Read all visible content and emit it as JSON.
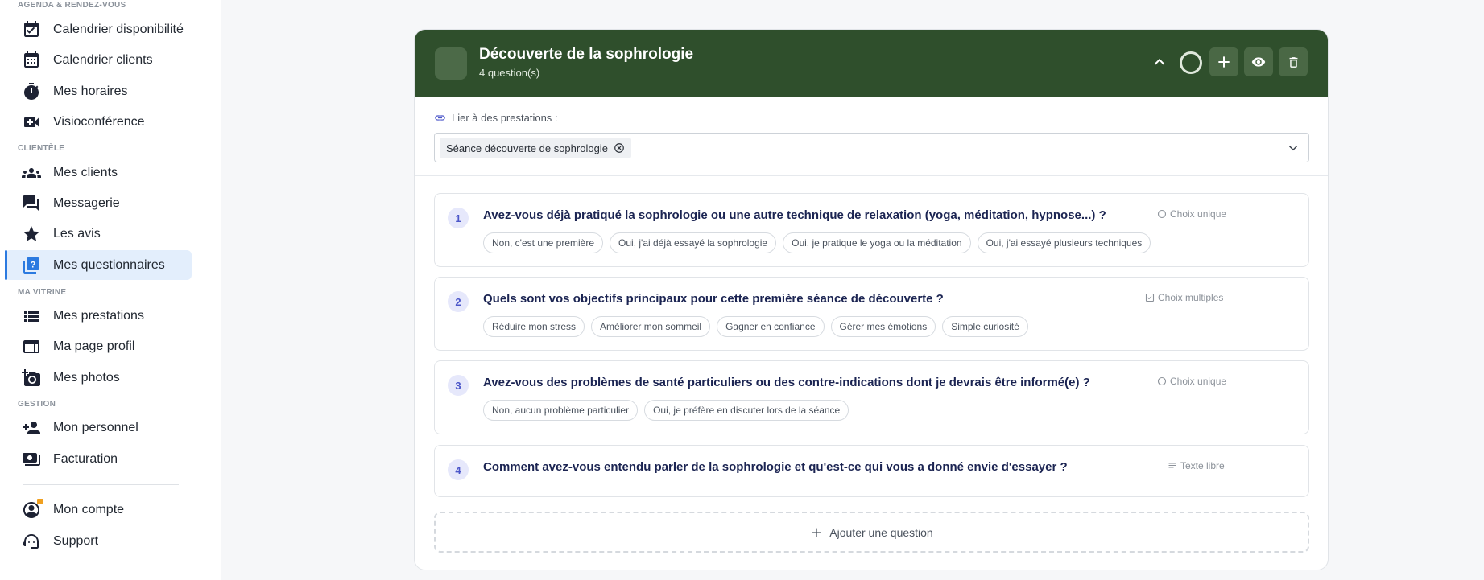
{
  "sidebar": {
    "sections": {
      "agenda": "AGENDA & RENDEZ-VOUS",
      "clientele": "CLIENTÈLE",
      "vitrine": "MA VITRINE",
      "gestion": "GESTION"
    },
    "items": {
      "cal_dispo": {
        "label": "Calendrier disponibilité",
        "icon": "calendar-check-icon"
      },
      "cal_clients": {
        "label": "Calendrier clients",
        "icon": "calendar-icon"
      },
      "horaires": {
        "label": "Mes horaires",
        "icon": "stopwatch-icon"
      },
      "visio": {
        "label": "Visioconférence",
        "icon": "video-plus-icon"
      },
      "clients": {
        "label": "Mes clients",
        "icon": "people-icon"
      },
      "messagerie": {
        "label": "Messagerie",
        "icon": "chat-icon"
      },
      "avis": {
        "label": "Les avis",
        "icon": "star-icon"
      },
      "questionnaires": {
        "label": "Mes questionnaires",
        "icon": "question-book-icon",
        "active": true
      },
      "prestations": {
        "label": "Mes prestations",
        "icon": "list-icon"
      },
      "profil": {
        "label": "Ma page profil",
        "icon": "web-page-icon"
      },
      "photos": {
        "label": "Mes photos",
        "icon": "camera-plus-icon"
      },
      "personnel": {
        "label": "Mon personnel",
        "icon": "person-add-icon"
      },
      "facturation": {
        "label": "Facturation",
        "icon": "money-icon"
      },
      "compte": {
        "label": "Mon compte",
        "icon": "account-circle-icon"
      },
      "support": {
        "label": "Support",
        "icon": "headset-icon"
      }
    }
  },
  "questionnaire": {
    "title": "Découverte de la sophrologie",
    "subtitle": "4 question(s)",
    "link_label": "Lier à des prestations :",
    "linked_service": "Séance découverte de sophrologie",
    "questions": [
      {
        "number": "1",
        "text": "Avez-vous déjà pratiqué la sophrologie ou une autre technique de relaxation (yoga, méditation, hypnose...) ?",
        "type": "Choix unique",
        "options": [
          "Non, c'est une première",
          "Oui, j'ai déjà essayé la sophrologie",
          "Oui, je pratique le yoga ou la méditation",
          "Oui, j'ai essayé plusieurs techniques"
        ]
      },
      {
        "number": "2",
        "text": "Quels sont vos objectifs principaux pour cette première séance de découverte ?",
        "type": "Choix multiples",
        "options": [
          "Réduire mon stress",
          "Améliorer mon sommeil",
          "Gagner en confiance",
          "Gérer mes émotions",
          "Simple curiosité"
        ]
      },
      {
        "number": "3",
        "text": "Avez-vous des problèmes de santé particuliers ou des contre-indications dont je devrais être informé(e) ?",
        "type": "Choix unique",
        "options": [
          "Non, aucun problème particulier",
          "Oui, je préfère en discuter lors de la séance"
        ]
      },
      {
        "number": "4",
        "text": "Comment avez-vous entendu parler de la sophrologie et qu'est-ce qui vous a donné envie d'essayer ?",
        "type": "Texte libre",
        "options": []
      }
    ],
    "add_question": "Ajouter une question"
  },
  "colors": {
    "header_bg": "#2f4f2c",
    "accent": "#2b7ae0",
    "question_number": "#4b56c9"
  }
}
